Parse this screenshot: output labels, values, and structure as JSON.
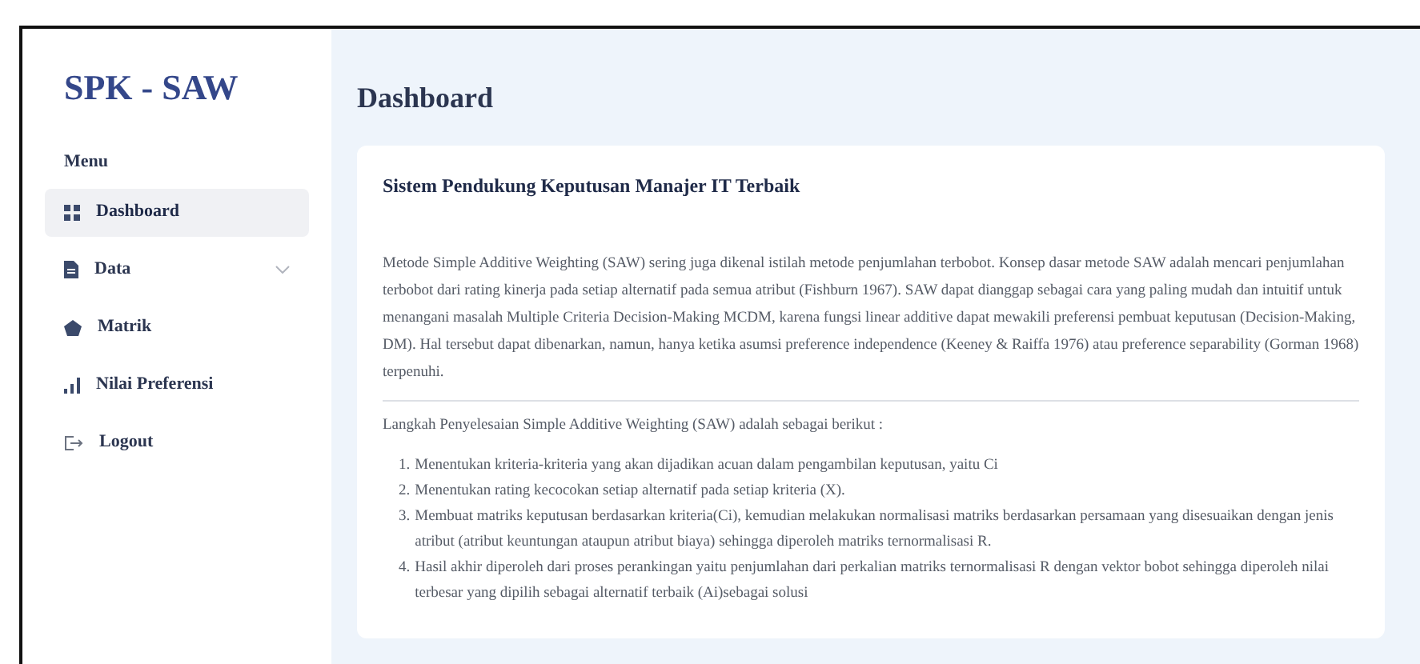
{
  "sidebar": {
    "brand": "SPK - SAW",
    "menu_heading": "Menu",
    "items": [
      {
        "label": "Dashboard",
        "selected": true,
        "has_submenu": false
      },
      {
        "label": "Data",
        "selected": false,
        "has_submenu": true
      },
      {
        "label": "Matrik",
        "selected": false,
        "has_submenu": false
      },
      {
        "label": "Nilai Preferensi",
        "selected": false,
        "has_submenu": false
      },
      {
        "label": "Logout",
        "selected": false,
        "has_submenu": false
      }
    ]
  },
  "page_title": "Dashboard",
  "card": {
    "title": "Sistem Pendukung Keputusan Manajer IT Terbaik",
    "intro": "Metode Simple Additive Weighting (SAW) sering juga dikenal istilah metode penjumlahan terbobot. Konsep dasar metode SAW adalah mencari penjumlahan terbobot dari rating kinerja pada setiap alternatif pada semua atribut (Fishburn 1967). SAW dapat dianggap sebagai cara yang paling mudah dan intuitif untuk menangani masalah Multiple Criteria Decision-Making MCDM, karena fungsi linear additive dapat mewakili preferensi pembuat keputusan (Decision-Making, DM). Hal tersebut dapat dibenarkan, namun, hanya ketika asumsi preference independence (Keeney & Raiffa 1976) atau preference separability (Gorman 1968) terpenuhi.",
    "steps_heading": "Langkah Penyelesaian Simple Additive Weighting (SAW) adalah sebagai berikut :",
    "steps": [
      {
        "number": "1.",
        "text": "Menentukan kriteria-kriteria yang akan dijadikan acuan dalam pengambilan keputusan, yaitu Ci"
      },
      {
        "number": "2.",
        "text": "Menentukan rating kecocokan setiap alternatif pada setiap kriteria (X)."
      },
      {
        "number": "3.",
        "text": "Membuat matriks keputusan berdasarkan kriteria(Ci), kemudian melakukan normalisasi matriks berdasarkan persamaan yang disesuaikan dengan jenis atribut (atribut keuntungan ataupun atribut biaya) sehingga diperoleh matriks ternormalisasi R."
      },
      {
        "number": "4.",
        "text": "Hasil akhir diperoleh dari proses perankingan yaitu penjumlahan dari perkalian matriks ternormalisasi R dengan vektor bobot sehingga diperoleh nilai terbesar yang dipilih sebagai alternatif terbaik (Ai)sebagai solusi"
      }
    ]
  }
}
